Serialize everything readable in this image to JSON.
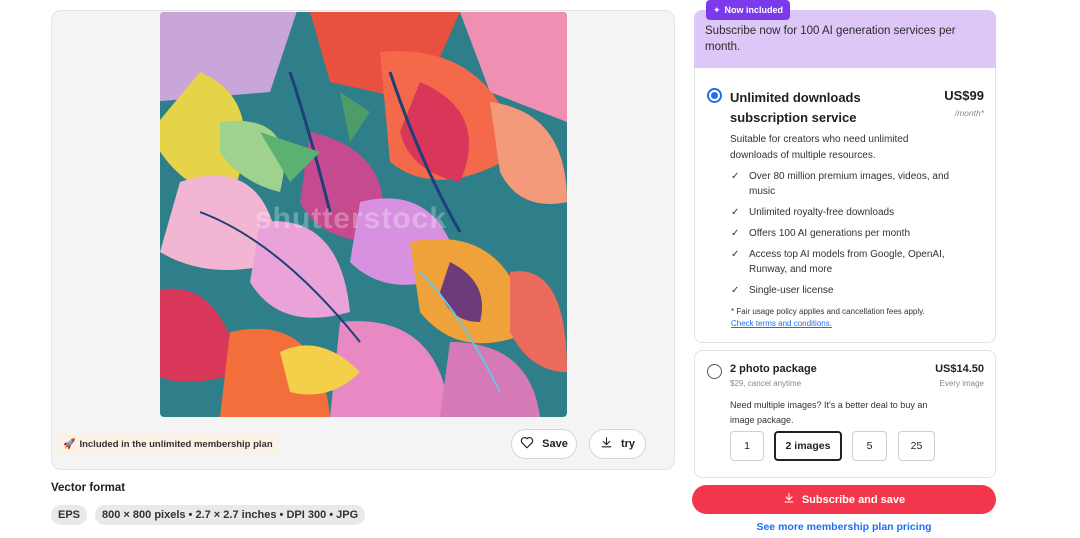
{
  "preview": {
    "watermark": "shutterstock",
    "plan_chip_label": "Included in the unlimited membership plan",
    "save_label": "Save",
    "try_label": "try"
  },
  "format": {
    "title": "Vector format",
    "tags": [
      "EPS",
      "800 × 800 pixels • 2.7 × 2.7 inches • DPI 300 • JPG"
    ]
  },
  "promo": {
    "badge": "Now included",
    "text": "Subscribe now for 100 AI generation services per month."
  },
  "subscription": {
    "title": "Unlimited downloads subscription service",
    "price": "US$99",
    "period": "/month*",
    "description": "Suitable for creators who need unlimited downloads of multiple resources.",
    "features": [
      "Over 80 million premium images, videos, and music",
      "Unlimited royalty-free downloads",
      "Offers 100 AI generations per month",
      "Access top AI models from Google, OpenAI, Runway, and more",
      "Single-user license"
    ],
    "fair_usage": "* Fair usage policy applies and cancellation fees apply.",
    "terms_link": "Check terms and conditions."
  },
  "package": {
    "title": "2 photo package",
    "subtitle": "$29, cancel anytime",
    "price": "US$14.50",
    "price_note": "Every image",
    "description": "Need multiple images? It's a better deal to buy an image package.",
    "quantities": [
      "1",
      "2 images",
      "5",
      "25"
    ]
  },
  "cta_label": "Subscribe and save",
  "more_link": "See more membership plan pricing",
  "colors": {
    "accent_blue": "#1d6ff2",
    "cta_red": "#f4364c",
    "promo_purple": "#dcc7f6",
    "badge_purple": "#7c3aed"
  },
  "icons": [
    "heart-icon",
    "download-icon",
    "rocket-icon",
    "sparkle-icon",
    "check-icon"
  ]
}
